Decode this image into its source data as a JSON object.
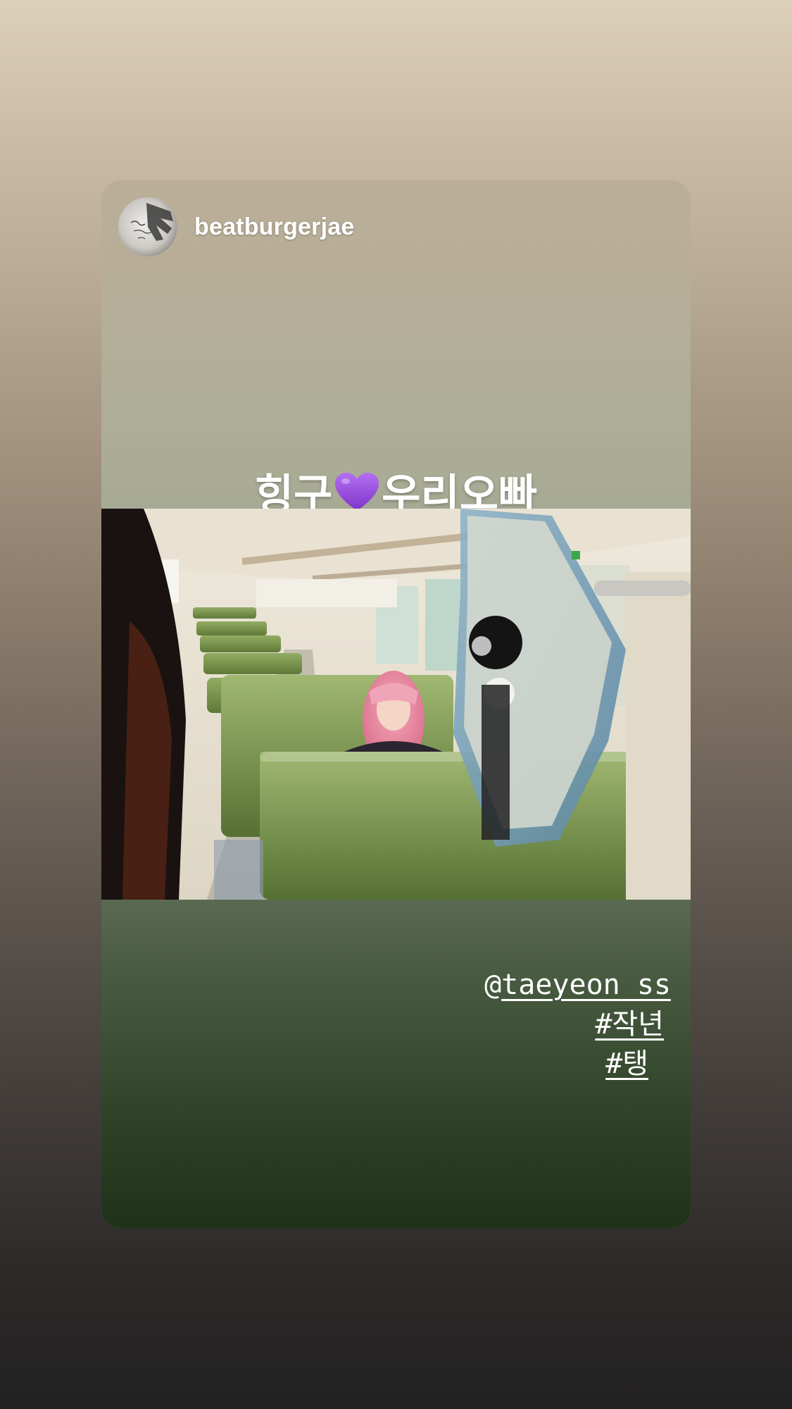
{
  "story": {
    "username": "beatburgerjae",
    "caption_left": "힝구",
    "caption_right": "우리오빠",
    "caption_emoji": "purple-heart-icon",
    "mention_at": "@",
    "mention_user": "taeyeon_ss",
    "hashtags": [
      "#작년",
      "#탱"
    ]
  },
  "colors": {
    "heart": "#9b4fe0",
    "text": "#ffffff",
    "seat_green": "#7e9a4e",
    "hair_pink": "#e98ca3",
    "light_blue": "#2f71b8"
  }
}
